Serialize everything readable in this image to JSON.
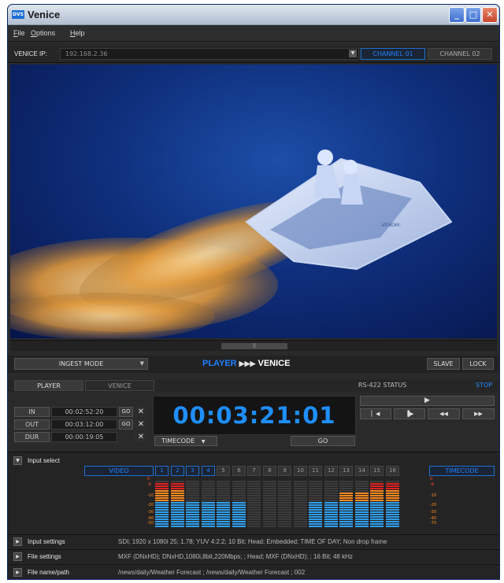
{
  "window": {
    "title": "Venice",
    "logo_text": "DVS"
  },
  "menu": [
    {
      "label": "File"
    },
    {
      "label": "Options"
    },
    {
      "label": "Help"
    }
  ],
  "connection": {
    "ip_label": "VENICE IP:",
    "ip_value": "192.168.2.36",
    "channel_tabs": [
      {
        "label": "CHANNEL 01",
        "active": true
      },
      {
        "label": "CHANNEL 02",
        "active": false
      }
    ]
  },
  "mode_bar": {
    "ingest_mode": "INGEST MODE",
    "player": "PLAYER",
    "arrows": "▶▶▶",
    "venice": "VENICE",
    "slave": "SLAVE",
    "lock": "LOCK"
  },
  "tabs": [
    {
      "label": "PLAYER",
      "active": true
    },
    {
      "label": "VENICE",
      "active": false
    }
  ],
  "rs422": {
    "label": "RS-422 STATUS",
    "state": "STOP",
    "state_color": "#1e90ff"
  },
  "timecodes": {
    "in_label": "IN",
    "in_value": "00:02:52:20",
    "out_label": "OUT",
    "out_value": "00:03:12:00",
    "dur_label": "DUR",
    "dur_value": "00:00:19:05",
    "go_label": "GO",
    "clear_icon": "✕"
  },
  "display": {
    "timecode": "00:03:21:01",
    "color": "#1f8fff",
    "source_select": "TIMECODE",
    "go_label": "GO"
  },
  "transport": {
    "play": "▶",
    "step_back": "▏◀",
    "step_forward": "▐▶",
    "rewind": "◀◀",
    "fast_forward": "▶▶"
  },
  "input_select": {
    "title": "Input select",
    "video_label": "VIDEO",
    "timecode_label": "TIMECODE",
    "channels": [
      {
        "num": "1",
        "active": true,
        "level": 0.95
      },
      {
        "num": "2",
        "active": true,
        "level": 0.95
      },
      {
        "num": "3",
        "active": true,
        "level": 0.55
      },
      {
        "num": "4",
        "active": true,
        "level": 0.55
      },
      {
        "num": "5",
        "active": false,
        "level": 0.55
      },
      {
        "num": "6",
        "active": false,
        "level": 0.55
      },
      {
        "num": "7",
        "active": false,
        "level": 0
      },
      {
        "num": "8",
        "active": false,
        "level": 0
      },
      {
        "num": "9",
        "active": false,
        "level": 0
      },
      {
        "num": "10",
        "active": false,
        "level": 0
      },
      {
        "num": "11",
        "active": false,
        "level": 0.55
      },
      {
        "num": "12",
        "active": false,
        "level": 0.55
      },
      {
        "num": "13",
        "active": false,
        "level": 0.75
      },
      {
        "num": "14",
        "active": false,
        "level": 0.75
      },
      {
        "num": "15",
        "active": false,
        "level": 0.95
      },
      {
        "num": "16",
        "active": false,
        "level": 0.95
      }
    ],
    "scale": [
      "0",
      "-6",
      "-10",
      "-20",
      "-30",
      "-40",
      "-50",
      "-60"
    ],
    "scale_right": [
      "0",
      "-6",
      "-10",
      "-20",
      "-30",
      "-40",
      "-70",
      "-60"
    ]
  },
  "sections": {
    "input_settings": {
      "title": "Input settings",
      "value": "SDI; 1920 x 1080i 25; 1.78; YUV 4:2:2; 10 Bit; Head; Embedded; TIME OF DAY; Non drop frame"
    },
    "file_settings": {
      "title": "File settings",
      "value": "MXF (DNxHD); DNxHD,1080i,8bit,220Mbps; ; Head; MXF (DNxHD); ; 16 Bit; 48 kHz"
    },
    "file_name": {
      "title": "File name/path",
      "value": "/news/daily/Weather Forecast ; /news/daily/Weather Forecast ; 002"
    }
  },
  "colors": {
    "accent": "#1e7fff",
    "meter_red": "#e02020",
    "meter_orange": "#ff8a1e",
    "meter_blue": "#2fa0f0"
  }
}
